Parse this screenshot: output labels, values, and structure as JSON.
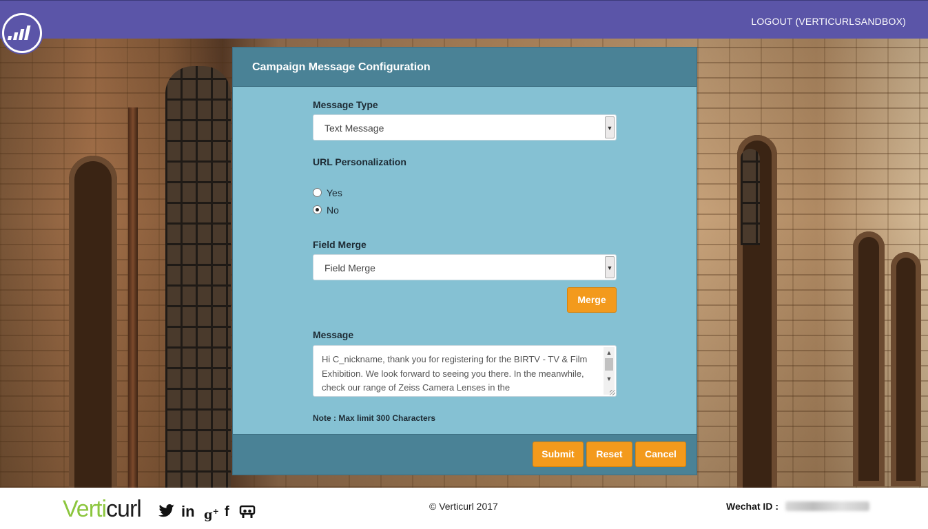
{
  "header": {
    "logout_label": "LOGOUT (VERTICURLSANDBOX)",
    "logo_icon": "chart-bars-logo-icon",
    "bg_color": "#5b55a8"
  },
  "modal": {
    "title": "Campaign Message Configuration",
    "message_type": {
      "label": "Message Type",
      "value": "Text Message"
    },
    "url_personalization": {
      "label": "URL Personalization",
      "options": [
        {
          "label": "Yes",
          "checked": false
        },
        {
          "label": "No",
          "checked": true
        }
      ]
    },
    "field_merge": {
      "label": "Field Merge",
      "value": "Field Merge",
      "merge_button": "Merge"
    },
    "message": {
      "label": "Message",
      "value": "Hi C_nickname, thank you for registering for the BIRTV - TV & Film Exhibition. We look forward to seeing you there. In the meanwhile, check our range of Zeiss Camera Lenses in the"
    },
    "note": "Note : Max limit 300 Characters",
    "footer_buttons": {
      "submit": "Submit",
      "reset": "Reset",
      "cancel": "Cancel"
    },
    "accent_color": "#f39a1c"
  },
  "footer": {
    "brand_part1": "Verti",
    "brand_part2": "curl",
    "social_icons": [
      "twitter-icon",
      "linkedin-icon",
      "google-plus-icon",
      "facebook-icon",
      "slideshare-icon"
    ],
    "copyright": "© Verticurl 2017",
    "wechat_label": "Wechat ID :"
  }
}
